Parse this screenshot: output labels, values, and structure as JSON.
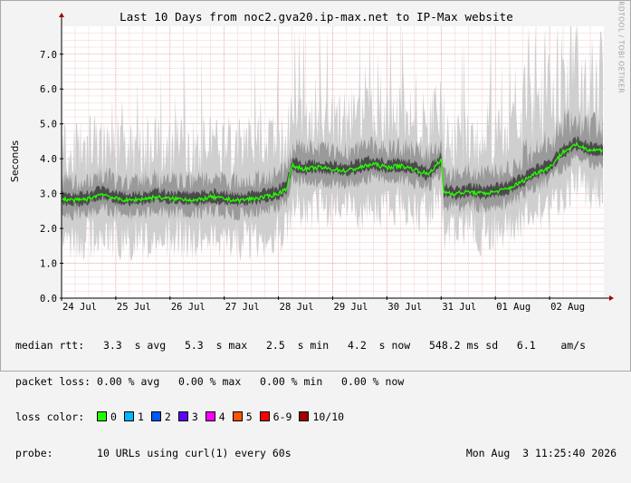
{
  "title": "Last 10 Days from noc2.gva20.ip-max.net to IP-Max website",
  "watermark": "RRDTOOL / TOBI OETIKER",
  "chart_data": {
    "type": "area",
    "title": "Last 10 Days from noc2.gva20.ip-max.net to IP-Max website",
    "ylabel": "Seconds",
    "xlabel": "",
    "ylim": [
      0,
      7.8
    ],
    "yticks": [
      "0.0",
      "1.0",
      "2.0",
      "3.0",
      "4.0",
      "5.0",
      "6.0",
      "7.0"
    ],
    "xticks": [
      "24 Jul",
      "25 Jul",
      "26 Jul",
      "27 Jul",
      "28 Jul",
      "29 Jul",
      "30 Jul",
      "31 Jul",
      "01 Aug",
      "02 Aug"
    ],
    "grid": true,
    "series": [
      {
        "name": "median rtt",
        "x": [
          0,
          0.25,
          0.5,
          0.75,
          1.0,
          1.25,
          1.5,
          1.75,
          2.0,
          2.25,
          2.5,
          2.75,
          3.0,
          3.25,
          3.5,
          3.75,
          4.0,
          4.15,
          4.25,
          4.5,
          4.75,
          5.0,
          5.25,
          5.5,
          5.75,
          6.0,
          6.25,
          6.5,
          6.75,
          7.0,
          7.05,
          7.25,
          7.5,
          7.75,
          8.0,
          8.25,
          8.5,
          8.75,
          9.0,
          9.25,
          9.5,
          9.75
        ],
        "values": [
          2.85,
          2.8,
          2.85,
          3.0,
          2.85,
          2.8,
          2.85,
          2.9,
          2.85,
          2.85,
          2.8,
          2.9,
          2.85,
          2.8,
          2.85,
          2.9,
          3.0,
          3.15,
          3.8,
          3.7,
          3.75,
          3.7,
          3.65,
          3.75,
          3.85,
          3.75,
          3.8,
          3.7,
          3.55,
          3.95,
          3.05,
          3.0,
          3.05,
          3.0,
          3.05,
          3.15,
          3.35,
          3.6,
          3.75,
          4.2,
          4.4,
          4.25
        ]
      }
    ]
  },
  "legend": {
    "median_label": "median rtt:",
    "median_values": "3.3  s avg   5.3  s max   2.5  s min   4.2  s now   548.2 ms sd   6.1    am/s",
    "loss_label": "packet loss:",
    "loss_values": "0.00 % avg   0.00 % max   0.00 % min   0.00 % now",
    "color_label": "loss color:",
    "loss_colors": [
      {
        "label": "0",
        "color": "#26ff00"
      },
      {
        "label": "1",
        "color": "#00b8ff"
      },
      {
        "label": "2",
        "color": "#0059ff"
      },
      {
        "label": "3",
        "color": "#5e00ff"
      },
      {
        "label": "4",
        "color": "#ff00ff"
      },
      {
        "label": "5",
        "color": "#ff5500"
      },
      {
        "label": "6-9",
        "color": "#ff0000"
      },
      {
        "label": "10/10",
        "color": "#a10000"
      }
    ],
    "probe_label": "probe:",
    "probe_value": "10 URLs using curl(1) every 60s",
    "timestamp": "Mon Aug  3 11:25:40 2026"
  }
}
